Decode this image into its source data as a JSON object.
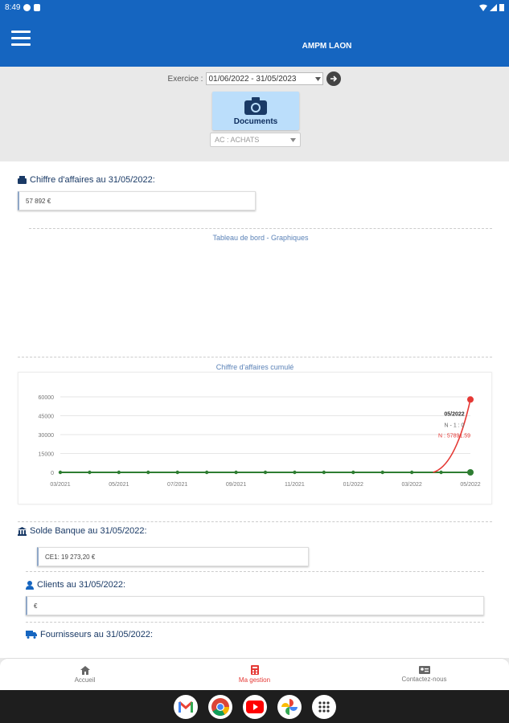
{
  "status_bar": {
    "time": "8:49"
  },
  "app_bar": {
    "title": "AMPM LAON"
  },
  "filters": {
    "exercise_label": "Exercice :",
    "exercise_value": "01/06/2022 - 31/05/2023",
    "documents_label": "Documents",
    "journal_value": "AC : ACHATS"
  },
  "sections": {
    "ca_title": "Chiffre d'affaires au 31/05/2022:",
    "ca_value": "57 892 €",
    "dashboard_caption": "Tableau de bord - Graphiques",
    "chart_caption": "Chiffre d'affaires cumulé",
    "bank_title": "Solde Banque au 31/05/2022:",
    "bank_value": "CE1: 19 273,20 €",
    "clients_title": "Clients au 31/05/2022:",
    "clients_value": "€",
    "suppliers_title": "Fournisseurs au 31/05/2022:"
  },
  "chart_data": {
    "type": "line",
    "x": [
      "03/2021",
      "04/2021",
      "05/2021",
      "06/2021",
      "07/2021",
      "08/2021",
      "09/2021",
      "10/2021",
      "11/2021",
      "12/2021",
      "01/2022",
      "02/2022",
      "03/2022",
      "04/2022",
      "05/2022"
    ],
    "x_tick_labels": [
      "03/2021",
      "05/2021",
      "07/2021",
      "09/2021",
      "11/2021",
      "01/2022",
      "03/2022",
      "05/2022"
    ],
    "y_ticks": [
      "0",
      "15000",
      "30000",
      "45000",
      "60000"
    ],
    "ylim": [
      0,
      60000
    ],
    "series": [
      {
        "name": "N",
        "color": "#e53935",
        "values": [
          0,
          0,
          0,
          0,
          0,
          0,
          0,
          0,
          0,
          0,
          0,
          0,
          0,
          0,
          57891.59
        ]
      },
      {
        "name": "N-1",
        "color": "#2e7d32",
        "values": [
          0,
          0,
          0,
          0,
          0,
          0,
          0,
          0,
          0,
          0,
          0,
          0,
          0,
          0,
          0
        ]
      }
    ],
    "tooltip": {
      "title": "05/2022",
      "line1": "N - 1 : 0",
      "line2": "N : 57891.59"
    },
    "grid": true
  },
  "bottom_nav": {
    "home_label": "Accueil",
    "manage_label": "Ma gestion",
    "contact_label": "Contactez-nous"
  },
  "colors": {
    "primary": "#1565c0",
    "accent": "#e53935",
    "series_prev": "#2e7d32"
  }
}
